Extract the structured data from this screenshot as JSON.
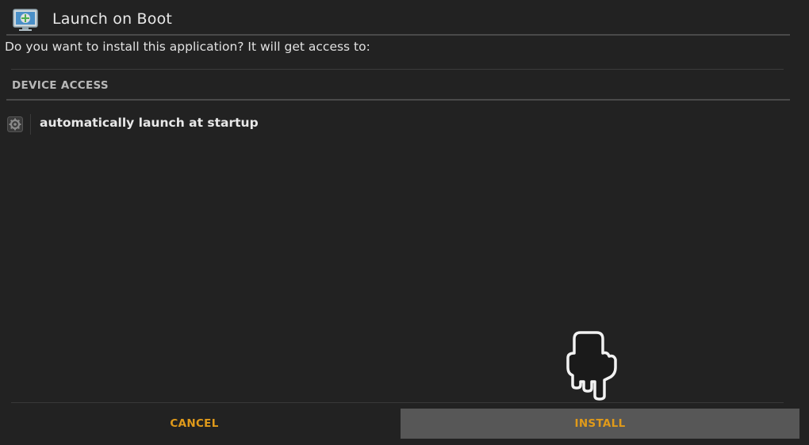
{
  "header": {
    "app_title": "Launch on Boot",
    "app_icon": "launch-on-boot-app-icon"
  },
  "prompt": {
    "question": "Do you want to install this application? It will get access to:"
  },
  "permissions": {
    "section_title": "DEVICE ACCESS",
    "items": [
      {
        "icon": "gear-icon",
        "label": "automatically launch at startup"
      }
    ]
  },
  "actions": {
    "cancel_label": "CANCEL",
    "install_label": "INSTALL"
  },
  "colors": {
    "background": "#222222",
    "accent": "#e09a1a",
    "focused_button": "#575757"
  },
  "overlay": {
    "pointer_icon": "hand-pointer-icon"
  }
}
